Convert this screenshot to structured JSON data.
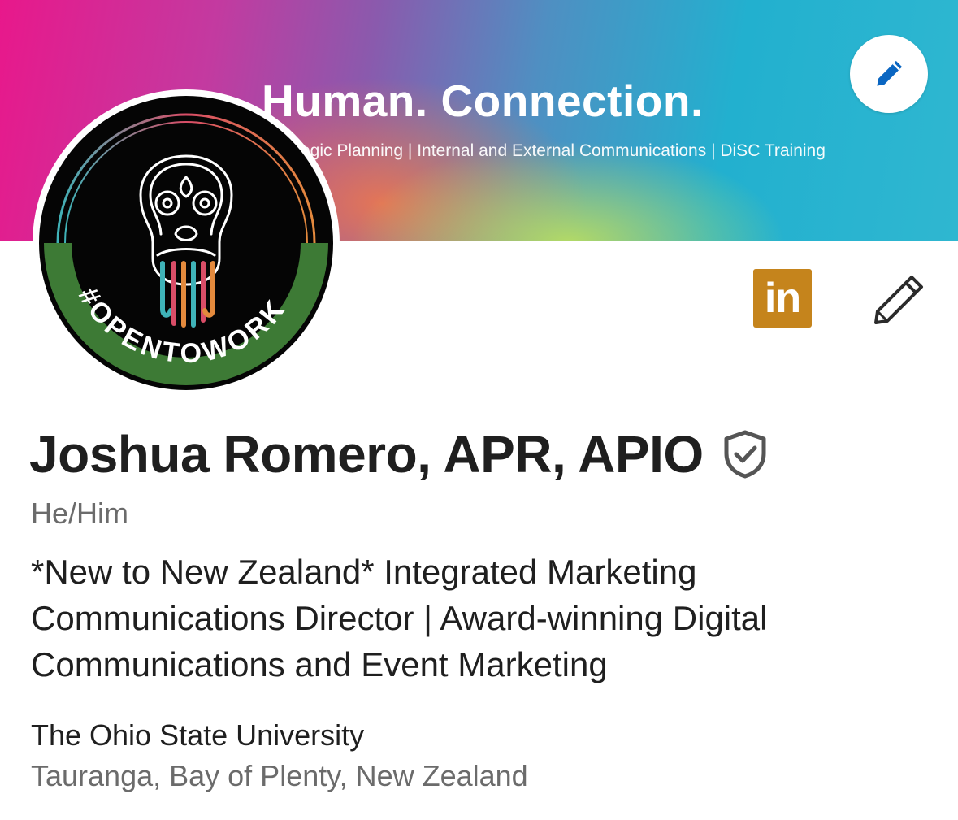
{
  "banner": {
    "headline": "Human. Connection.",
    "subline": "egic Planning | Internal and External Communications | DiSC Training",
    "edit_icon": "pencil-icon"
  },
  "avatar": {
    "frame_text": "#OPENTOWORK",
    "frame_color": "#3d7a35",
    "image": "maori-tiki-face-illustration"
  },
  "actions": {
    "linkedin_label": "in",
    "linkedin_color": "#c5841c",
    "edit_icon": "pencil-icon"
  },
  "profile": {
    "name": "Joshua Romero, APR, APIO",
    "pronouns": "He/Him",
    "headline": "*New to New Zealand* Integrated Marketing Communications Director | Award-winning Digital Communications and Event Marketing",
    "education": "The Ohio State University",
    "location": "Tauranga, Bay of Plenty, New Zealand"
  },
  "colors": {
    "primary_text": "#1f1f1f",
    "secondary_text": "#6b6b6b",
    "accent_blue": "#0a66c2"
  }
}
